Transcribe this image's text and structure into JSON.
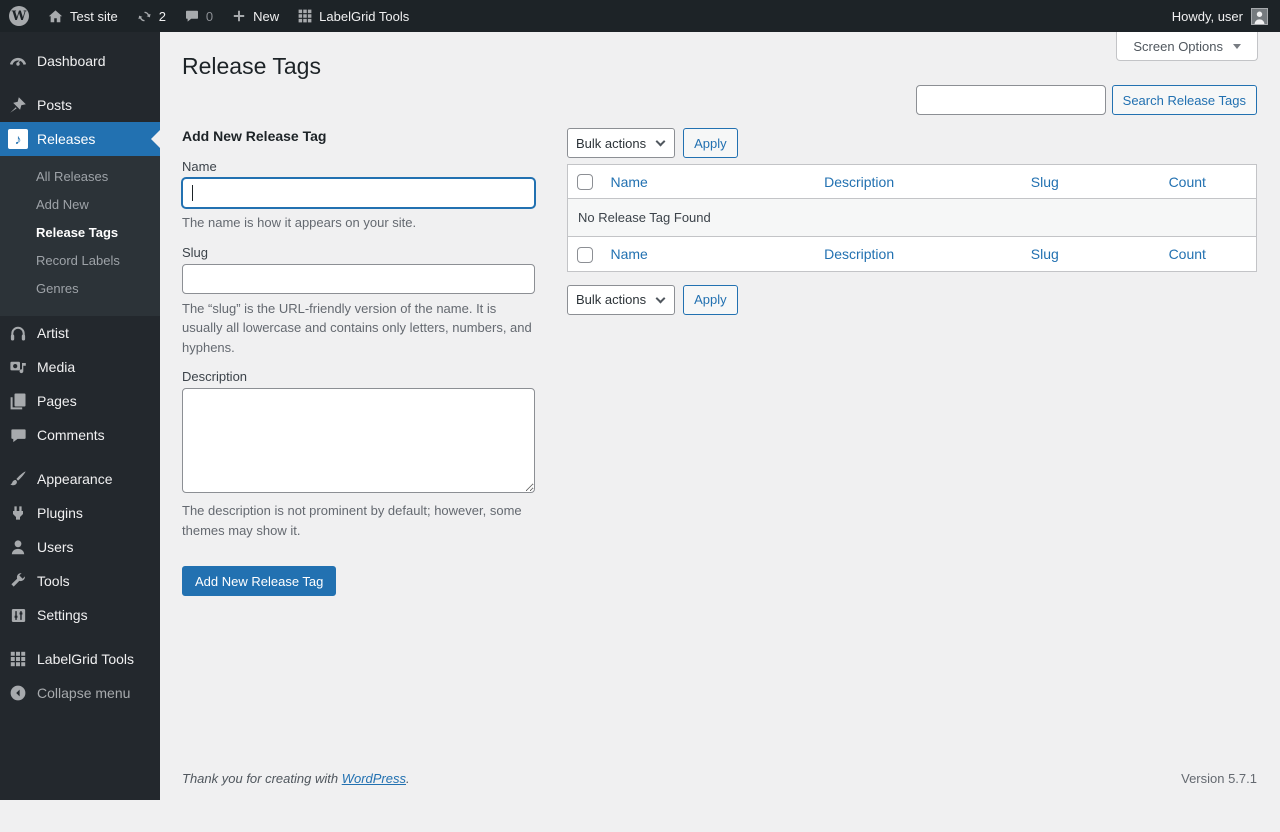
{
  "admin_bar": {
    "wp_logo": "W",
    "site_name": "Test site",
    "updates_count": "2",
    "comments_count": "0",
    "new_label": "New",
    "labelgrid_label": "LabelGrid Tools",
    "howdy": "Howdy, user"
  },
  "sidebar": {
    "items": [
      {
        "label": "Dashboard"
      },
      {
        "label": "Posts"
      },
      {
        "label": "Releases"
      },
      {
        "label": "Artist"
      },
      {
        "label": "Media"
      },
      {
        "label": "Pages"
      },
      {
        "label": "Comments"
      },
      {
        "label": "Appearance"
      },
      {
        "label": "Plugins"
      },
      {
        "label": "Users"
      },
      {
        "label": "Tools"
      },
      {
        "label": "Settings"
      },
      {
        "label": "LabelGrid Tools"
      },
      {
        "label": "Collapse menu"
      }
    ],
    "releases_submenu": [
      {
        "label": "All Releases"
      },
      {
        "label": "Add New"
      },
      {
        "label": "Release Tags"
      },
      {
        "label": "Record Labels"
      },
      {
        "label": "Genres"
      }
    ]
  },
  "page": {
    "title": "Release Tags",
    "screen_options": "Screen Options",
    "search_button": "Search Release Tags"
  },
  "form": {
    "heading": "Add New Release Tag",
    "name_label": "Name",
    "name_help": "The name is how it appears on your site.",
    "slug_label": "Slug",
    "slug_help": "The “slug” is the URL-friendly version of the name. It is usually all lowercase and contains only letters, numbers, and hyphens.",
    "description_label": "Description",
    "description_help": "The description is not prominent by default; however, some themes may show it.",
    "submit_label": "Add New Release Tag"
  },
  "table": {
    "bulk_actions_label": "Bulk actions",
    "apply_label": "Apply",
    "columns": [
      "Name",
      "Description",
      "Slug",
      "Count"
    ],
    "empty_message": "No Release Tag Found"
  },
  "footer": {
    "thanks_prefix": "Thank you for creating with ",
    "wordpress_link": "WordPress",
    "thanks_suffix": ".",
    "version": "Version 5.7.1"
  },
  "colors": {
    "accent": "#2271b1",
    "admin_bar_bg": "#1d2327",
    "menu_bg": "#23282d",
    "submenu_bg": "#2c3338",
    "content_bg": "#f0f0f1"
  }
}
